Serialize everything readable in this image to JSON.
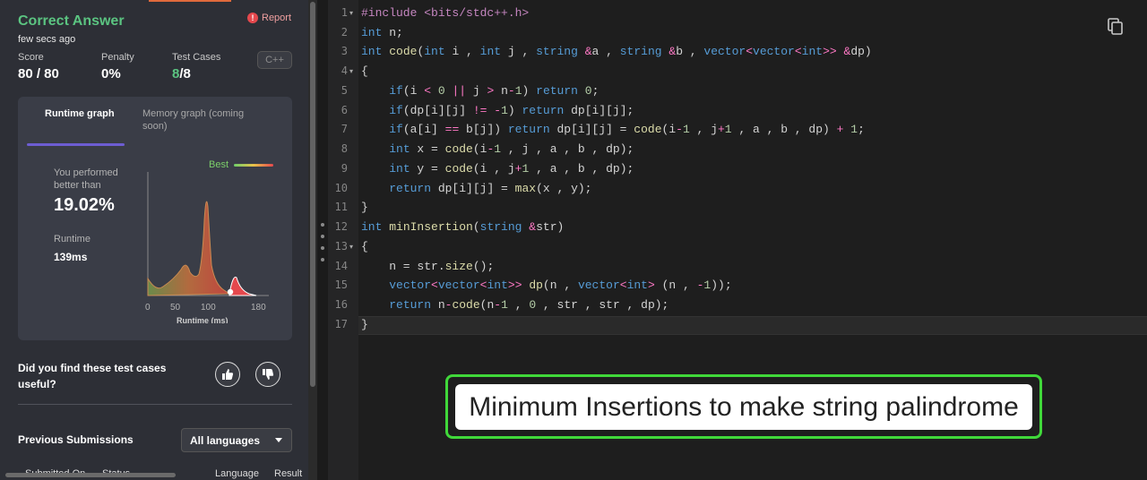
{
  "result": {
    "title": "Correct Answer",
    "time": "few secs ago",
    "report_label": "Report",
    "report_icon": "!"
  },
  "stats": {
    "score_label": "Score",
    "score_value": "80 / 80",
    "penalty_label": "Penalty",
    "penalty_value": "0%",
    "testcases_label": "Test Cases",
    "testcases_passed": "8",
    "testcases_total": "/8",
    "language": "C++"
  },
  "graph": {
    "tab_runtime": "Runtime graph",
    "tab_memory": "Memory graph (coming soon)",
    "performed_label": "You performed better than",
    "performed_value": "19.02%",
    "runtime_label": "Runtime",
    "runtime_value": "139ms",
    "best_label": "Best",
    "x_ticks": [
      "0",
      "50",
      "100",
      "180"
    ],
    "x_label": "Runtime (ms)"
  },
  "feedback": {
    "question": "Did you find these test cases useful?"
  },
  "submissions": {
    "title": "Previous Submissions",
    "language_filter": "All languages",
    "cut_col1": "Submitted On",
    "cut_col2": "Status",
    "cut_col3": "Language",
    "cut_col4": "Result"
  },
  "editor": {
    "line_numbers": [
      "1",
      "2",
      "3",
      "4",
      "5",
      "6",
      "7",
      "8",
      "9",
      "10",
      "11",
      "12",
      "13",
      "14",
      "15",
      "16",
      "17"
    ],
    "lines": [
      "#include <bits/stdc++.h>",
      "int n;",
      "int code(int i , int j , string &a , string &b , vector<vector<int>> &dp)",
      "{",
      "    if(i < 0 || j > n-1) return 0;",
      "    if(dp[i][j] != -1) return dp[i][j];",
      "    if(a[i] == b[j]) return dp[i][j] = code(i-1 , j+1 , a , b , dp) + 1;",
      "    int x = code(i-1 , j , a , b , dp);",
      "    int y = code(i , j+1 , a , b , dp);",
      "    return dp[i][j] = max(x , y);",
      "}",
      "int minInsertion(string &str)",
      "{",
      "    n = str.size();",
      "    vector<vector<int>> dp(n , vector<int> (n , -1));",
      "    return n-code(n-1 , 0 , str , str , dp);",
      "}"
    ]
  },
  "caption": "Minimum Insertions to make string palindrome",
  "icons": {
    "copy": "copy-icon",
    "thumbs_up": "thumbs-up-icon",
    "thumbs_down": "thumbs-down-icon",
    "dropdown": "chevron-down-icon"
  },
  "colors": {
    "success": "#5bc481",
    "accent": "#6d5dd3",
    "caption_border": "#40d83a"
  }
}
